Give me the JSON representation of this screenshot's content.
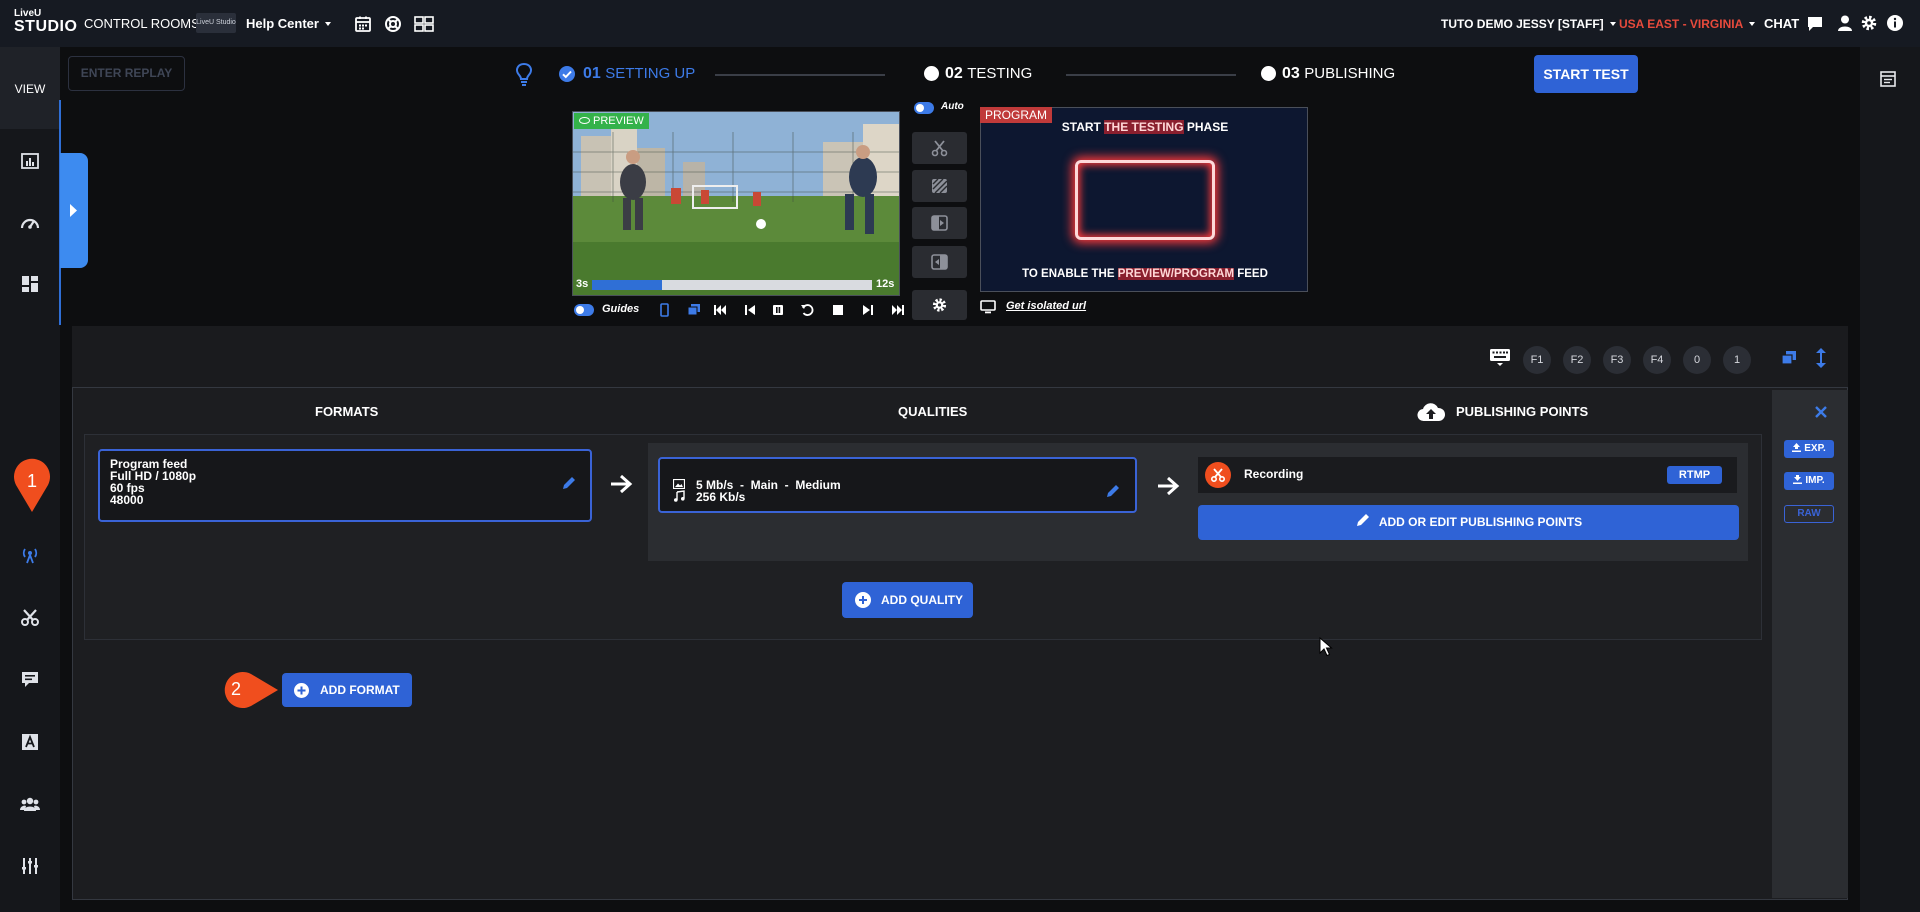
{
  "topbar": {
    "logo_line1": "LiveU",
    "logo_line2": "STUDIO",
    "control_rooms": "CONTROL ROOMS",
    "help_thumb": "LiveU Studio",
    "help_center": "Help Center",
    "user": "TUTO DEMO JESSY [STAFF]",
    "region": "USA EAST - VIRGINIA",
    "chat": "CHAT"
  },
  "sidebar": {
    "view_label": "VIEW"
  },
  "header": {
    "replay_label": "ENTER REPLAY",
    "steps": [
      {
        "num": "01",
        "label": "SETTING UP"
      },
      {
        "num": "02",
        "label": "TESTING"
      },
      {
        "num": "03",
        "label": "PUBLISHING"
      }
    ],
    "start_test": "START TEST"
  },
  "preview": {
    "tag": "PREVIEW",
    "time_start": "3s",
    "time_end": "12s",
    "progress": 0.25,
    "guides_label": "Guides"
  },
  "switcher": {
    "auto_label": "Auto"
  },
  "program": {
    "tag": "PROGRAM",
    "line1_a": "START ",
    "line1_b": "THE TESTING",
    "line1_c": " PHASE",
    "line2_a": "TO ENABLE THE ",
    "line2_b": "PREVIEW/PROGRAM",
    "line2_c": " FEED",
    "isolated_url": "Get isolated url"
  },
  "panel": {
    "fkeys": [
      "F1",
      "F2",
      "F3",
      "F4",
      "0",
      "1"
    ],
    "col_formats": "FORMATS",
    "col_qualities": "QUALITIES",
    "col_publishing": "PUBLISHING POINTS",
    "format": {
      "line1": "Program feed",
      "line2": "Full HD / 1080p",
      "line3": "60 fps",
      "line4": "48000"
    },
    "quality": {
      "video": "5 Mb/s  -  Main  -  Medium",
      "audio": "256 Kb/s"
    },
    "recording": "Recording",
    "rtmp": "RTMP",
    "add_pub": "ADD OR EDIT PUBLISHING POINTS",
    "add_quality": "ADD QUALITY",
    "add_format": "ADD FORMAT",
    "exp": "EXP.",
    "imp": "IMP.",
    "raw": "RAW"
  },
  "badges": {
    "one": "1",
    "two": "2"
  },
  "colors": {
    "accent": "#2f63d6",
    "region": "#e84a3c",
    "badge": "#f04e1e",
    "preview_tag": "#34b24a",
    "program_tag": "#c03a3a"
  }
}
